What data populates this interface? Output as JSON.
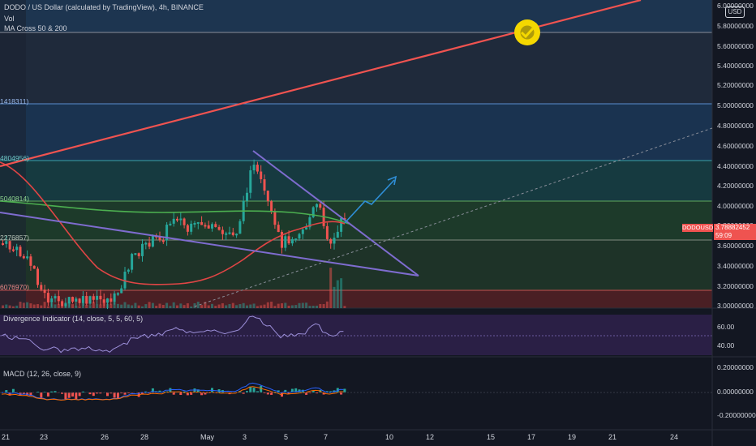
{
  "header": {
    "symbol_title": "DODO / US Dollar (calculated by TradingView), 4h, BINANCE",
    "vol_label": "Vol",
    "ma_label": "MA Cross 50 & 200"
  },
  "price_axis": {
    "ticks": [
      "6.00000000",
      "5.80000000",
      "5.60000000",
      "5.40000000",
      "5.20000000",
      "5.00000000",
      "4.80000000",
      "4.60000000",
      "4.40000000",
      "4.20000000",
      "4.00000000",
      "3.80000000",
      "3.60000000",
      "3.40000000",
      "3.20000000",
      "3.00000000"
    ],
    "currency_button": "USD",
    "symbol_tag": "DODOUSD",
    "last_price": "3.78882452",
    "countdown": "59:09"
  },
  "fib_labels": [
    "1418311)",
    "4804956)",
    "5040814)",
    "2276857)",
    "6076970)"
  ],
  "indicator1": {
    "label": "Divergence Indicator (14, close, 5, 5, 60, 5)",
    "ticks": [
      "60.00",
      "40.00"
    ]
  },
  "indicator2": {
    "label": "MACD (12, 26, close, 9)",
    "ticks": [
      "0.20000000",
      "0.00000000",
      "-0.20000000"
    ]
  },
  "time_axis": {
    "ticks": [
      "21",
      "23",
      "26",
      "28",
      "May",
      "3",
      "5",
      "7",
      "10",
      "12",
      "15",
      "17",
      "19",
      "21",
      "24"
    ]
  },
  "colors": {
    "background": "#131722",
    "up_candle": "#26a69a",
    "down_candle": "#ef5350",
    "trend_red": "#f05350",
    "ma200": "#4caf50",
    "triangle_lines": "#7e6ccf",
    "arrow": "#2f8fd8",
    "check_badge": "#f5d800"
  }
}
